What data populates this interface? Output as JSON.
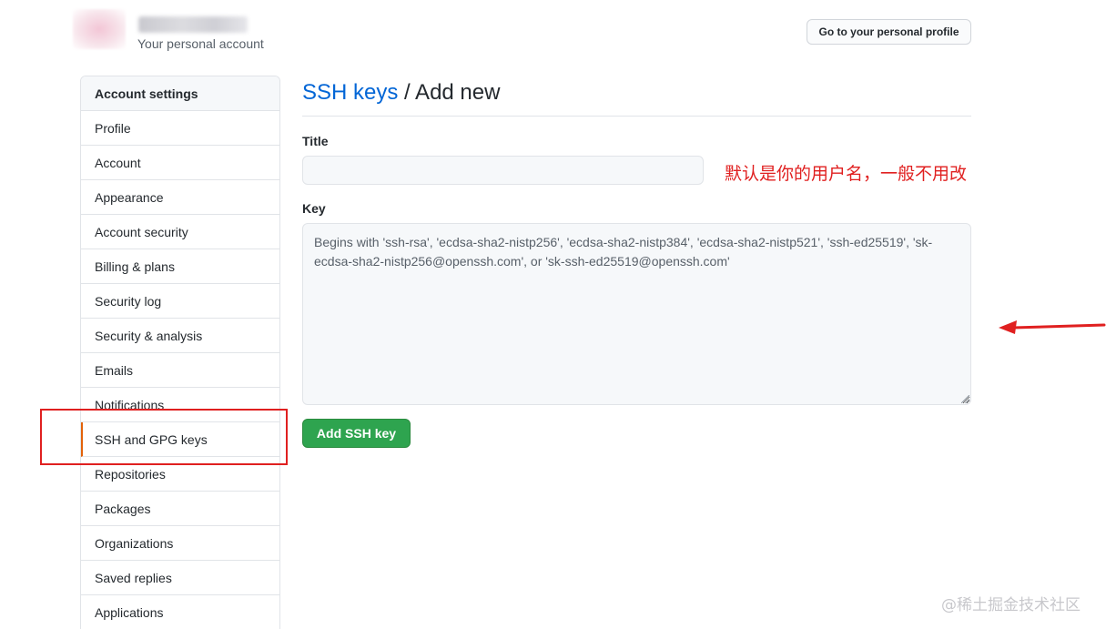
{
  "header": {
    "account_subtitle": "Your personal account",
    "profile_button": "Go to your personal profile"
  },
  "sidebar": {
    "heading": "Account settings",
    "items": [
      {
        "label": "Profile"
      },
      {
        "label": "Account"
      },
      {
        "label": "Appearance"
      },
      {
        "label": "Account security"
      },
      {
        "label": "Billing & plans"
      },
      {
        "label": "Security log"
      },
      {
        "label": "Security & analysis"
      },
      {
        "label": "Emails"
      },
      {
        "label": "Notifications"
      },
      {
        "label": "SSH and GPG keys",
        "selected": true
      },
      {
        "label": "Repositories"
      },
      {
        "label": "Packages"
      },
      {
        "label": "Organizations"
      },
      {
        "label": "Saved replies"
      },
      {
        "label": "Applications"
      }
    ]
  },
  "main": {
    "breadcrumb_link": "SSH keys",
    "breadcrumb_rest": " / Add new",
    "title_label": "Title",
    "title_value": "",
    "key_label": "Key",
    "key_placeholder": "Begins with 'ssh-rsa', 'ecdsa-sha2-nistp256', 'ecdsa-sha2-nistp384', 'ecdsa-sha2-nistp521', 'ssh-ed25519', 'sk-ecdsa-sha2-nistp256@openssh.com', or 'sk-ssh-ed25519@openssh.com'",
    "submit_button": "Add SSH key"
  },
  "annotations": {
    "title_note": "默认是你的用户名，一般不用改",
    "color": "#e02020"
  },
  "watermark": "@稀土掘金技术社区",
  "colors": {
    "link": "#0366d6",
    "primary_button": "#2ea44f",
    "selected_indicator": "#e36209"
  }
}
